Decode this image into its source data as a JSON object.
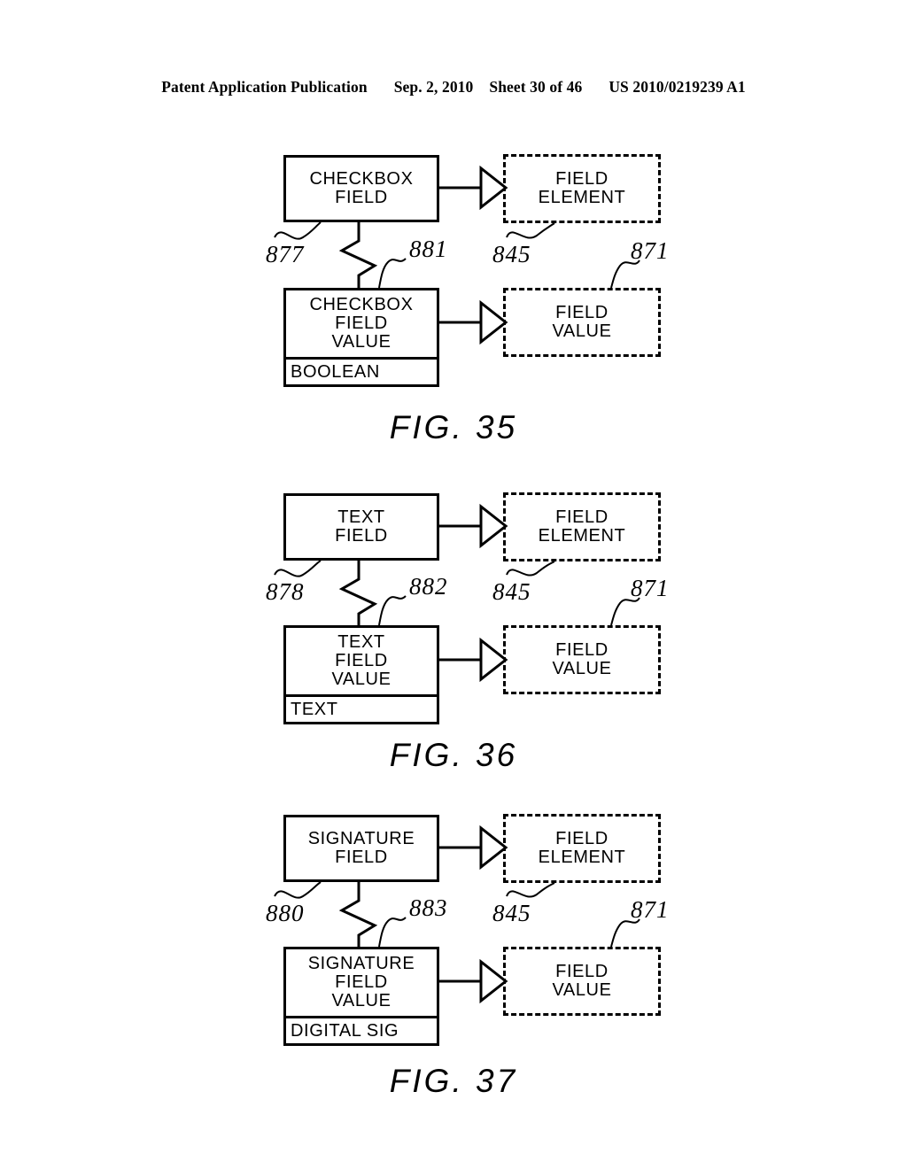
{
  "header": {
    "publication": "Patent Application Publication",
    "date": "Sep. 2, 2010",
    "sheet": "Sheet 30 of 46",
    "patent_number": "US 2010/0219239 A1"
  },
  "figures": [
    {
      "caption": "FIG. 35",
      "field_node": "CHECKBOX\nFIELD",
      "value_node": "CHECKBOX\nFIELD\nVALUE",
      "value_type": "BOOLEAN",
      "element_node": "FIELD\nELEMENT",
      "value_element_node": "FIELD\nVALUE",
      "refs": {
        "field": "877",
        "value": "881",
        "element": "845",
        "value_element": "871"
      }
    },
    {
      "caption": "FIG. 36",
      "field_node": "TEXT\nFIELD",
      "value_node": "TEXT\nFIELD\nVALUE",
      "value_type": "TEXT",
      "element_node": "FIELD\nELEMENT",
      "value_element_node": "FIELD\nVALUE",
      "refs": {
        "field": "878",
        "value": "882",
        "element": "845",
        "value_element": "871"
      }
    },
    {
      "caption": "FIG. 37",
      "field_node": "SIGNATURE\nFIELD",
      "value_node": "SIGNATURE\nFIELD\nVALUE",
      "value_type": "DIGITAL SIG",
      "element_node": "FIELD\nELEMENT",
      "value_element_node": "FIELD\nVALUE",
      "refs": {
        "field": "880",
        "value": "883",
        "element": "845",
        "value_element": "871"
      }
    }
  ],
  "colors": {
    "ink": "#000000",
    "paper": "#ffffff"
  }
}
